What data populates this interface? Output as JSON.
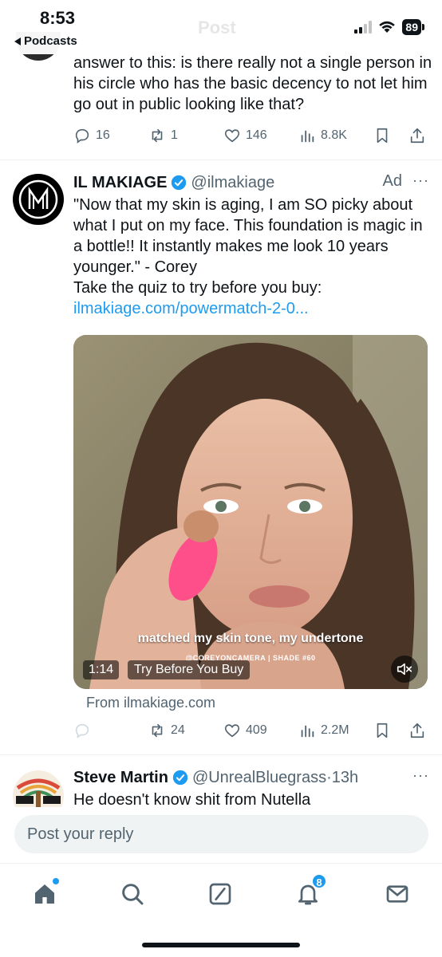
{
  "status_bar": {
    "time": "8:53",
    "back_app": "Podcasts",
    "ghost_title": "Post",
    "battery": "89"
  },
  "previous_tweet": {
    "text": "answer to this: is there really not a single person in his circle who has the basic decency to not let him go out in public looking like that?",
    "actions": {
      "replies": "16",
      "reposts": "1",
      "likes": "146",
      "views": "8.8K"
    }
  },
  "ad_tweet": {
    "author_name": "IL MAKIAGE",
    "handle": "@ilmakiage",
    "ad_label": "Ad",
    "more": "···",
    "text": "\"Now that my skin is aging, I am SO picky about what I put on my face. This foundation is magic in a bottle!! It instantly makes me look 10 years younger.\" - Corey",
    "text_line2": "Take the quiz to try before you buy:",
    "link": "ilmakiage.com/powermatch-2-0...",
    "media": {
      "caption": "matched my skin tone, my undertone",
      "watermark": "@COREYONCAMERA | SHADE #60",
      "duration": "1:14",
      "cta": "Try Before You Buy"
    },
    "from_line": "From ilmakiage.com",
    "actions": {
      "reposts": "24",
      "likes": "409",
      "views": "2.2M"
    }
  },
  "reply_tweet": {
    "author_name": "Steve Martin",
    "handle": "@UnrealBluegrass",
    "time": "·13h",
    "more": "···",
    "text": "He doesn't know shit from Nutella"
  },
  "reply_bar": {
    "placeholder": "Post your reply"
  },
  "bottom_nav": {
    "notification_count": "8"
  },
  "colors": {
    "accent": "#1d9bf0",
    "text": "#0f1419",
    "secondary": "#536471",
    "reply_bg": "#eff3f4"
  }
}
